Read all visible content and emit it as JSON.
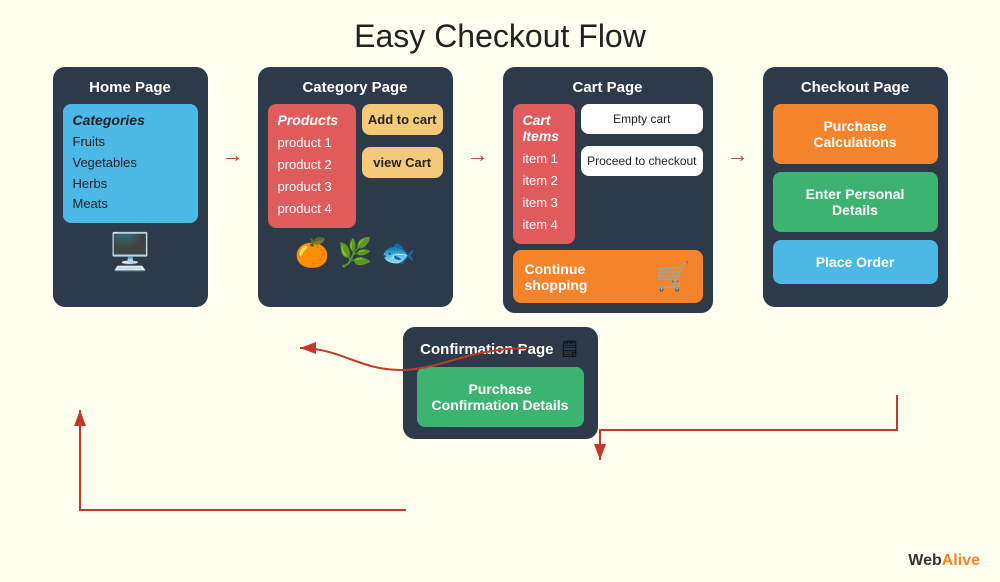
{
  "title": "Easy Checkout Flow",
  "pages": {
    "home": {
      "title": "Home Page",
      "categories_title": "Categories",
      "categories": [
        "Fruits",
        "Vegetables",
        "Herbs",
        "Meats"
      ]
    },
    "category": {
      "title": "Category Page",
      "products_title": "Products",
      "products": [
        "product 1",
        "product 2",
        "product 3",
        "product 4"
      ],
      "btn_add_cart": "Add to cart",
      "btn_view_cart": "view Cart"
    },
    "cart": {
      "title": "Cart Page",
      "items_title": "Cart Items",
      "items": [
        "item 1",
        "item 2",
        "item 3",
        "item 4"
      ],
      "btn_empty_cart": "Empty cart",
      "btn_proceed": "Proceed to checkout",
      "btn_continue": "Continue shopping"
    },
    "checkout": {
      "title": "Checkout Page",
      "btn_purchase_calc": "Purchase Calculations",
      "btn_personal_details": "Enter Personal Details",
      "btn_place_order": "Place Order"
    },
    "confirmation": {
      "title": "Confirmation Page",
      "icon": "🗒",
      "btn_details": "Purchase Confirmation Details"
    }
  },
  "brand": {
    "web": "Web",
    "alive": "Alive"
  }
}
